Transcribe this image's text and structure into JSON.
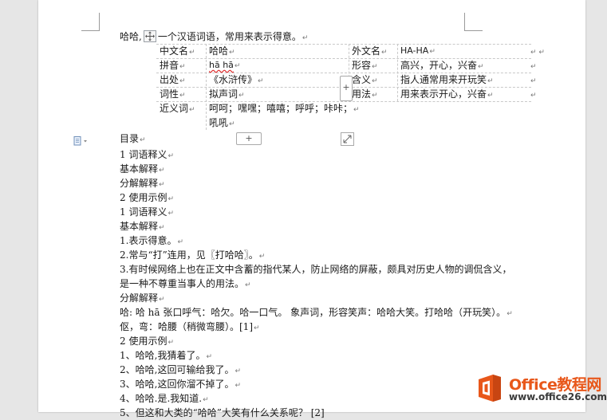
{
  "intro": {
    "head": "哈哈,",
    "text": "一个汉语词语，常用来表示得意。"
  },
  "table": {
    "rows": [
      {
        "k1": "中文名",
        "v1": "哈哈",
        "k2": "外文名",
        "v2": "HA-HA"
      },
      {
        "k1": "拼音",
        "v1": "hā hā",
        "k2": "形容",
        "v2": "高兴，开心，兴奋"
      },
      {
        "k1": "出处",
        "v1": "《水浒传》",
        "k2": "含义",
        "v2": "指人通常用来开玩笑"
      },
      {
        "k1": "词性",
        "v1": "拟声词",
        "k2": "用法",
        "v2": "用来表示开心，兴奋"
      },
      {
        "k1": "近义词",
        "v1": "呵呵；嘿嘿；嘻嘻；呼呼；咔咔；",
        "v1b": "吼吼"
      }
    ],
    "add_row_label": "+",
    "add_col_label": "+"
  },
  "body_lines": [
    "目录",
    "1 词语释义",
    "基本解释",
    "分解解释",
    "2 使用示例",
    "1 词语释义",
    "基本解释",
    "1.表示得意。",
    "2.常与“打”连用，见〖打哈哈〗。",
    "3.有时候网络上也在正文中含蓄的指代某人，防止网络的屏蔽，颇具对历史人物的调侃含义，",
    "是一种不尊重当事人的用法。",
    "分解解释",
    "哈: 哈 hā 张口呼气：哈欠。哈一口气。 象声词，形容笑声：哈哈大笑。打哈哈（开玩笑）。",
    "伛，弯：哈腰（稍微弯腰）。[1]",
    "2 使用示例",
    "1、哈哈,我猜着了。",
    "2、哈哈,这回可输给我了。",
    "3、哈哈,这回你溜不掉了。",
    "4、哈哈.是.我知道.",
    "5、但这和大类的“哈哈”大笑有什么关系呢？ [2]"
  ],
  "logo": {
    "title": "Office教程网",
    "url": "www.office26.com"
  },
  "colors": {
    "logo_orange": "#e8571a",
    "page_bg": "#ffffff",
    "canvas_bg": "#e6e6e6"
  },
  "icons": {
    "move": "move-arrows-icon",
    "doc": "document-icon",
    "resize": "resize-diagonal-icon"
  }
}
